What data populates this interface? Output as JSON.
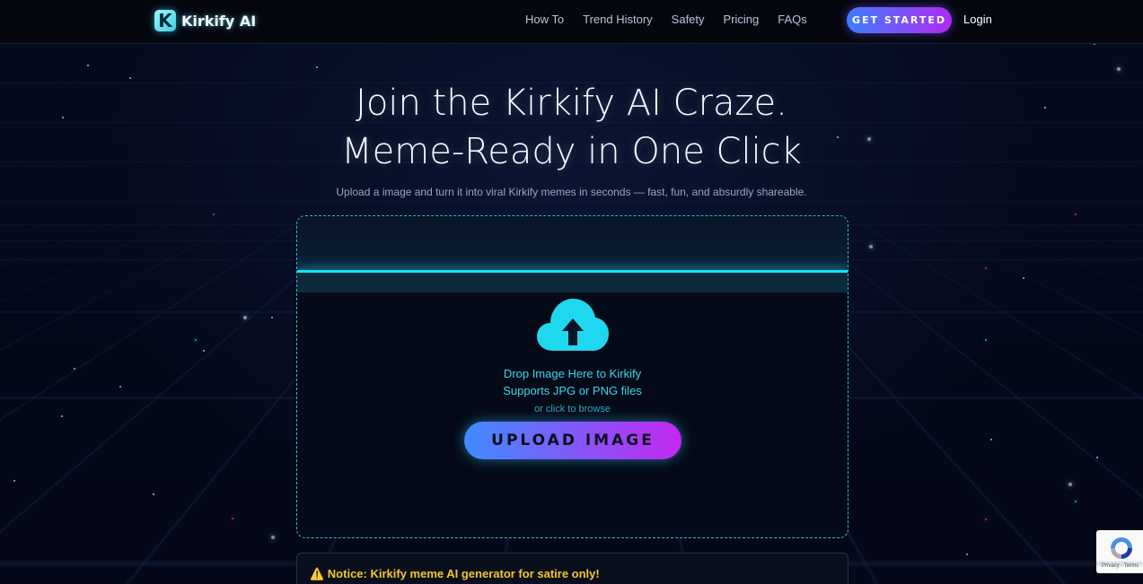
{
  "nav": {
    "brand_initial": "K",
    "brand_name": "Kirkify AI",
    "links": [
      "How To",
      "Trend History",
      "Safety",
      "Pricing",
      "FAQs"
    ],
    "cta_label": "GET STARTED",
    "login_label": "Login"
  },
  "hero": {
    "title_line1": "Join the Kirkify AI Craze.",
    "title_line2": "Meme-Ready in One Click",
    "subtitle": "Upload a image and turn it into viral Kirkify memes in seconds — fast, fun, and absurdly shareable."
  },
  "upload": {
    "icon": "cloud-upload-icon",
    "drop_line1": "Drop Image Here to Kirkify",
    "drop_line2": "Supports JPG or PNG files",
    "browse_hint": "or click to browse",
    "button_label": "UPLOAD IMAGE"
  },
  "notice": {
    "text": "⚠️ Notice: Kirkify meme AI generator for satire only!"
  },
  "recaptcha": {
    "footer": "Privacy - Terms"
  },
  "colors": {
    "accent_cyan": "#18e3f5",
    "gradient_start": "#3f8cff",
    "gradient_end": "#c327f2",
    "notice_yellow": "#f7c52c"
  }
}
